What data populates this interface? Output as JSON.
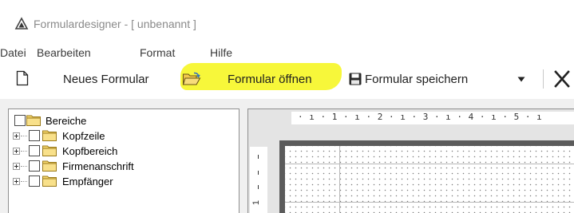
{
  "window": {
    "title": "Formulardesigner - [ unbenannt ]",
    "app_icon": "triangle-app-icon"
  },
  "menu": {
    "items": [
      "Datei",
      "Bearbeiten",
      "Format",
      "Hilfe"
    ]
  },
  "toolbar": {
    "new_label": "Neues Formular",
    "open_label": "Formular öffnen",
    "save_label": "Formular speichern",
    "icons": [
      "new-document-icon",
      "open-folder-icon",
      "save-disk-icon",
      "dropdown-arrow-icon",
      "close-x-icon"
    ],
    "highlight_color": "#f7f73a"
  },
  "tree": {
    "items": [
      {
        "label": "Bereiche",
        "level": 0,
        "checked": false,
        "expandable": false
      },
      {
        "label": "Kopfzeile",
        "level": 1,
        "checked": false,
        "expandable": true
      },
      {
        "label": "Kopfbereich",
        "level": 1,
        "checked": false,
        "expandable": true
      },
      {
        "label": "Firmenanschrift",
        "level": 1,
        "checked": false,
        "expandable": true
      },
      {
        "label": "Empfänger",
        "level": 1,
        "checked": false,
        "expandable": true
      }
    ]
  },
  "designer": {
    "ruler_top": "· ı · 1 · ı · 2 · ı · 3 · ı · 4 · ı · 5 · ı",
    "ruler_left_number": "1"
  },
  "colors": {
    "folder": "#f5d76e",
    "accent_close": "#222222"
  }
}
